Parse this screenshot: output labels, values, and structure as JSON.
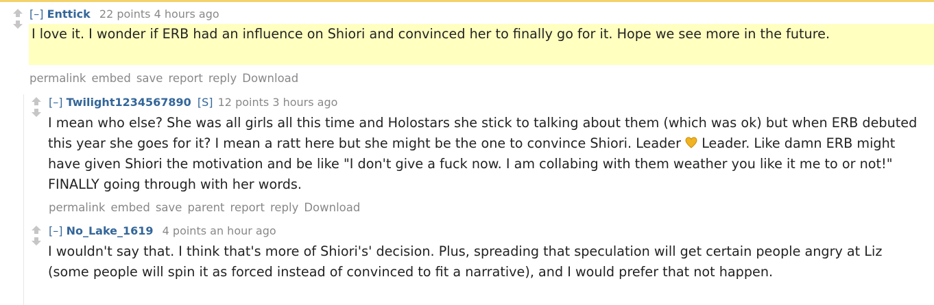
{
  "accent": {
    "highlight": "#ffffc0",
    "link": "#336699",
    "muted": "#888888",
    "topline": "#f3d26b"
  },
  "comments": [
    {
      "toggle": "[–]",
      "author": "Enttick",
      "points": "22 points",
      "time": "4 hours ago",
      "body": "I love it. I wonder if ERB had an influence on Shiori and convinced her to finally go for it. Hope we see more in the future.",
      "actions": [
        "permalink",
        "embed",
        "save",
        "report",
        "reply",
        "Download"
      ]
    },
    {
      "toggle": "[–]",
      "author": "Twilight1234567890",
      "submitter_tag": "[S]",
      "points": "12 points",
      "time": "3 hours ago",
      "body": "I mean who else? She was all girls all this time and Holostars she stick to talking about them (which was ok) but when ERB debuted this year she goes for it? I mean a ratt here but she might be the one to convince Shiori. Leader",
      "flair_icon": "yellow-heart-icon",
      "body_after_icon": " Leader. Like damn ERB might have given Shiori the motivation and be like \"I don't give a fuck now. I am collabing with them weather you like it me to or not!\" FINALLY going through with her words.",
      "actions": [
        "permalink",
        "embed",
        "save",
        "parent",
        "report",
        "reply",
        "Download"
      ]
    },
    {
      "toggle": "[–]",
      "author": "No_Lake_1619",
      "points": "4 points",
      "time": "an hour ago",
      "body": "I wouldn't say that. I think that's more of Shiori's' decision. Plus, spreading that speculation will get certain people angry at Liz (some people will spin it as forced instead of convinced to fit a narrative), and I would prefer that not happen."
    }
  ]
}
